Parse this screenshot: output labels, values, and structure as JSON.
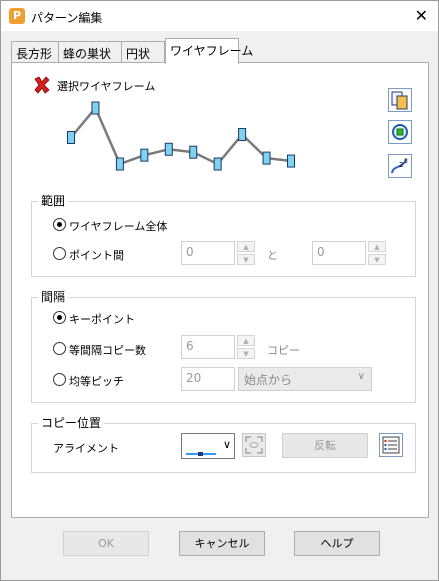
{
  "window": {
    "title": "パターン編集",
    "close_glyph": "✕",
    "app_icon_letter": "P"
  },
  "tabs": [
    {
      "label": "長方形",
      "active": false
    },
    {
      "label": "蜂の巣状",
      "active": false
    },
    {
      "label": "円状",
      "active": false
    },
    {
      "label": "ワイヤフレーム",
      "active": true
    }
  ],
  "selection": {
    "label": "選択ワイヤフレーム",
    "icon": "red-x-icon"
  },
  "wire_preview": {
    "points": [
      [
        0,
        0
      ],
      [
        1,
        -1
      ],
      [
        2,
        0.9
      ],
      [
        3,
        0.6
      ],
      [
        4,
        0.4
      ],
      [
        5,
        0.5
      ],
      [
        6,
        0.9
      ],
      [
        7,
        -0.1
      ],
      [
        8,
        0.7
      ],
      [
        9,
        0.8
      ]
    ]
  },
  "side_buttons": [
    {
      "icon": "copy-pages-icon"
    },
    {
      "icon": "target-circle-icon"
    },
    {
      "icon": "curve-points-icon"
    }
  ],
  "range": {
    "title": "範囲",
    "opt_whole": "ワイヤフレーム全体",
    "opt_points": "ポイント間",
    "from_value": "0",
    "to_label": "と",
    "to_value": "0",
    "selected": "whole"
  },
  "spacing": {
    "title": "間隔",
    "opt_keypoints": "キーポイント",
    "opt_equal_copies": "等間隔コピー数",
    "copies_value": "6",
    "copies_unit": "コピー",
    "opt_equal_pitch": "均等ピッチ",
    "pitch_value": "20",
    "pitch_origin": "始点から",
    "selected": "keypoints"
  },
  "copy_pos": {
    "title": "コピー位置",
    "align_label": "アライメント",
    "flip_label": "反転",
    "align_accent": "#3399ff"
  },
  "footer": {
    "ok": "OK",
    "cancel": "キャンセル",
    "help": "ヘルプ"
  }
}
